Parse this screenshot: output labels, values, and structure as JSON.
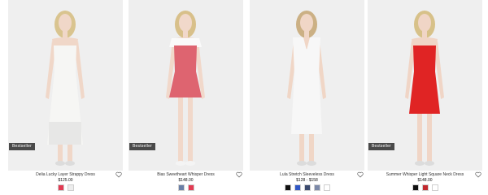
{
  "products": [
    {
      "name": "Delia Lucky Layer Strappy Dress",
      "price": "$125.00",
      "badge": "Bestseller",
      "swatches": [
        "#e23b53",
        "#ededed"
      ],
      "bg": "#efefef",
      "dress": "#f6f6f4",
      "hair": "#d9c48f",
      "skin": "#f0d7c8"
    },
    {
      "name": "Bias Sweetheart Whisper Dress",
      "price": "$148.00",
      "badge": "Bestseller",
      "swatches": [
        "#6a7fa6",
        "#e23b53"
      ],
      "bg": "#eeeeee",
      "dress": "#de6470",
      "hair": "#d8c08a",
      "skin": "#f1d8ca"
    },
    {
      "name": "Lula Stretch Sleeveless Dress",
      "price": "$128 - $158",
      "badge": "",
      "swatches": [
        "#111111",
        "#2f56c4",
        "#3b4a6e",
        "#7c89a8",
        "#ffffff"
      ],
      "bg": "#efefef",
      "dress": "#f7f7f7",
      "hair": "#cbb084",
      "skin": "#f0d6c6"
    },
    {
      "name": "Summer Whisper Light Square Neck Dress",
      "price": "$148.00",
      "badge": "Bestseller",
      "swatches": [
        "#111111",
        "#c22a2f",
        "#ffffff"
      ],
      "bg": "#efefef",
      "dress": "#e02424",
      "hair": "#d7c189",
      "skin": "#f0d5c6"
    }
  ]
}
